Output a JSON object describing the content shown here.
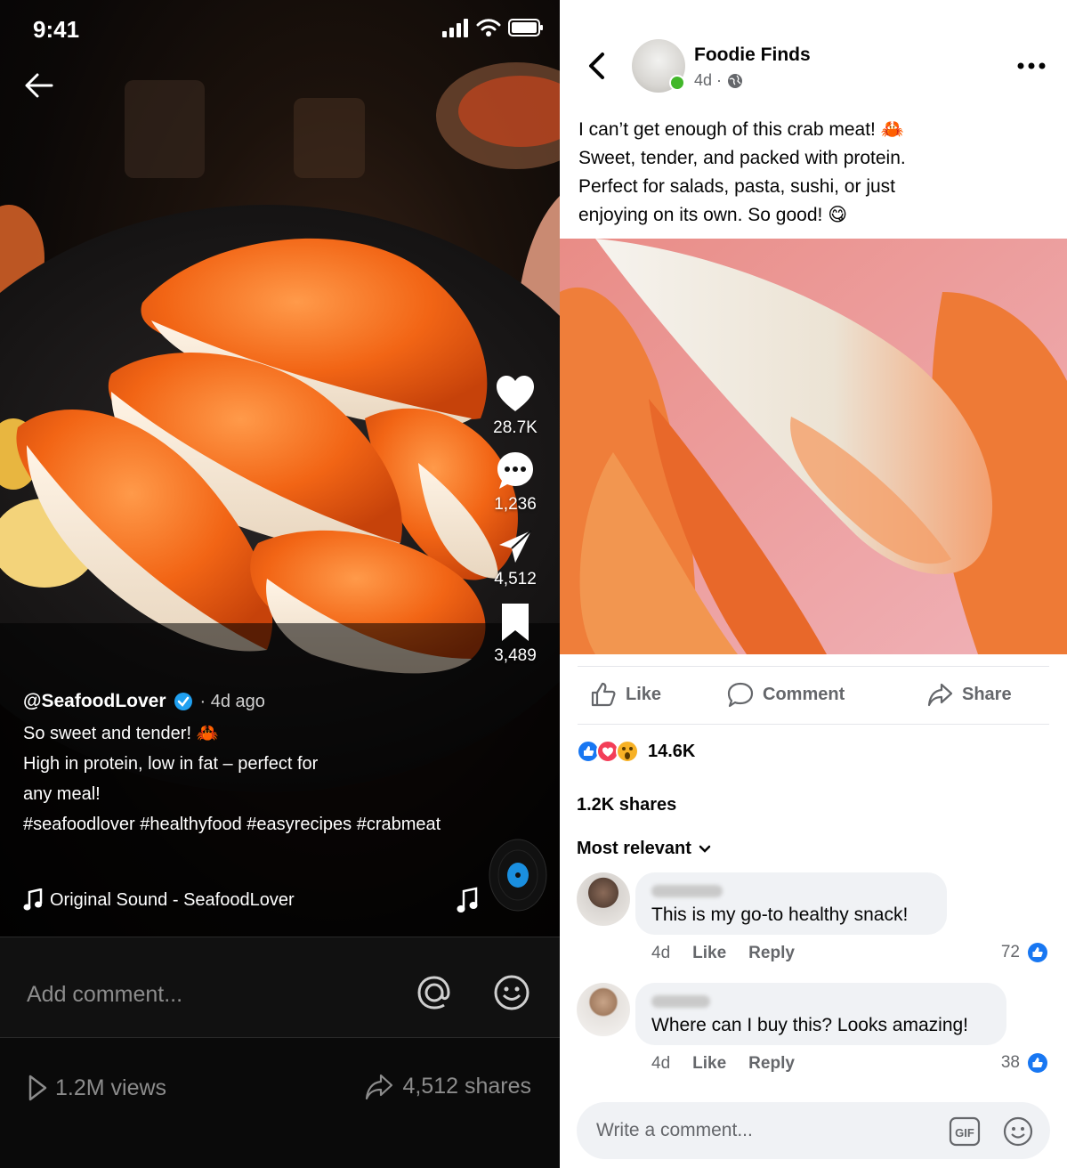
{
  "left": {
    "status_time": "9:41",
    "username": "@SeafoodLover",
    "time_ago": "· 4d ago",
    "caption_lines": [
      "So sweet and tender! 🦀",
      "High in protein, low in fat – perfect for",
      "any meal!",
      "#seafoodlover #healthyfood #easyrecipes #crabmeat"
    ],
    "likes": "28.7K",
    "comments": "1,236",
    "shares_count": "4,512",
    "saves": "3,489",
    "sound": "Original Sound - SeafoodLover",
    "comment_placeholder": "Add comment...",
    "views": "1.2M views",
    "shares_text": "4,512 shares"
  },
  "right": {
    "page_name": "Foodie Finds",
    "post_age": "4d ·",
    "post_text": [
      "I can’t get enough of this crab meat! 🦀",
      "Sweet, tender, and packed with protein.",
      "Perfect for salads, pasta, sushi, or just",
      "enjoying on its own. So good! 😋"
    ],
    "actions": {
      "like": "Like",
      "comment": "Comment",
      "share": "Share"
    },
    "reaction_count": "14.6K",
    "shares": "1.2K shares",
    "sort_label": "Most relevant",
    "comments": [
      {
        "text": "This is my go-to healthy snack!",
        "age": "4d",
        "like": "Like",
        "reply": "Reply",
        "likes": "72"
      },
      {
        "text": "Where can I buy this? Looks amazing!",
        "age": "4d",
        "like": "Like",
        "reply": "Reply",
        "likes": "38"
      }
    ],
    "write_placeholder": "Write a comment...",
    "gif_label": "GIF"
  },
  "colors": {
    "fb_blue": "#1877f2",
    "verified_blue": "#20a0f0",
    "crab_orange": "#f06a1e"
  }
}
